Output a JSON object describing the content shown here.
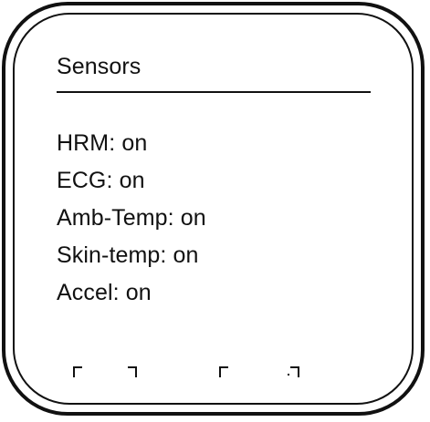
{
  "screen": {
    "title": "Sensors"
  },
  "sensors": [
    {
      "label": "HRM: on"
    },
    {
      "label": "ECG: on"
    },
    {
      "label": "Amb-Temp: on"
    },
    {
      "label": "Skin-temp: on"
    },
    {
      "label": "Accel: on"
    }
  ],
  "theme": {
    "foreground": "#111111",
    "background": "#ffffff"
  }
}
